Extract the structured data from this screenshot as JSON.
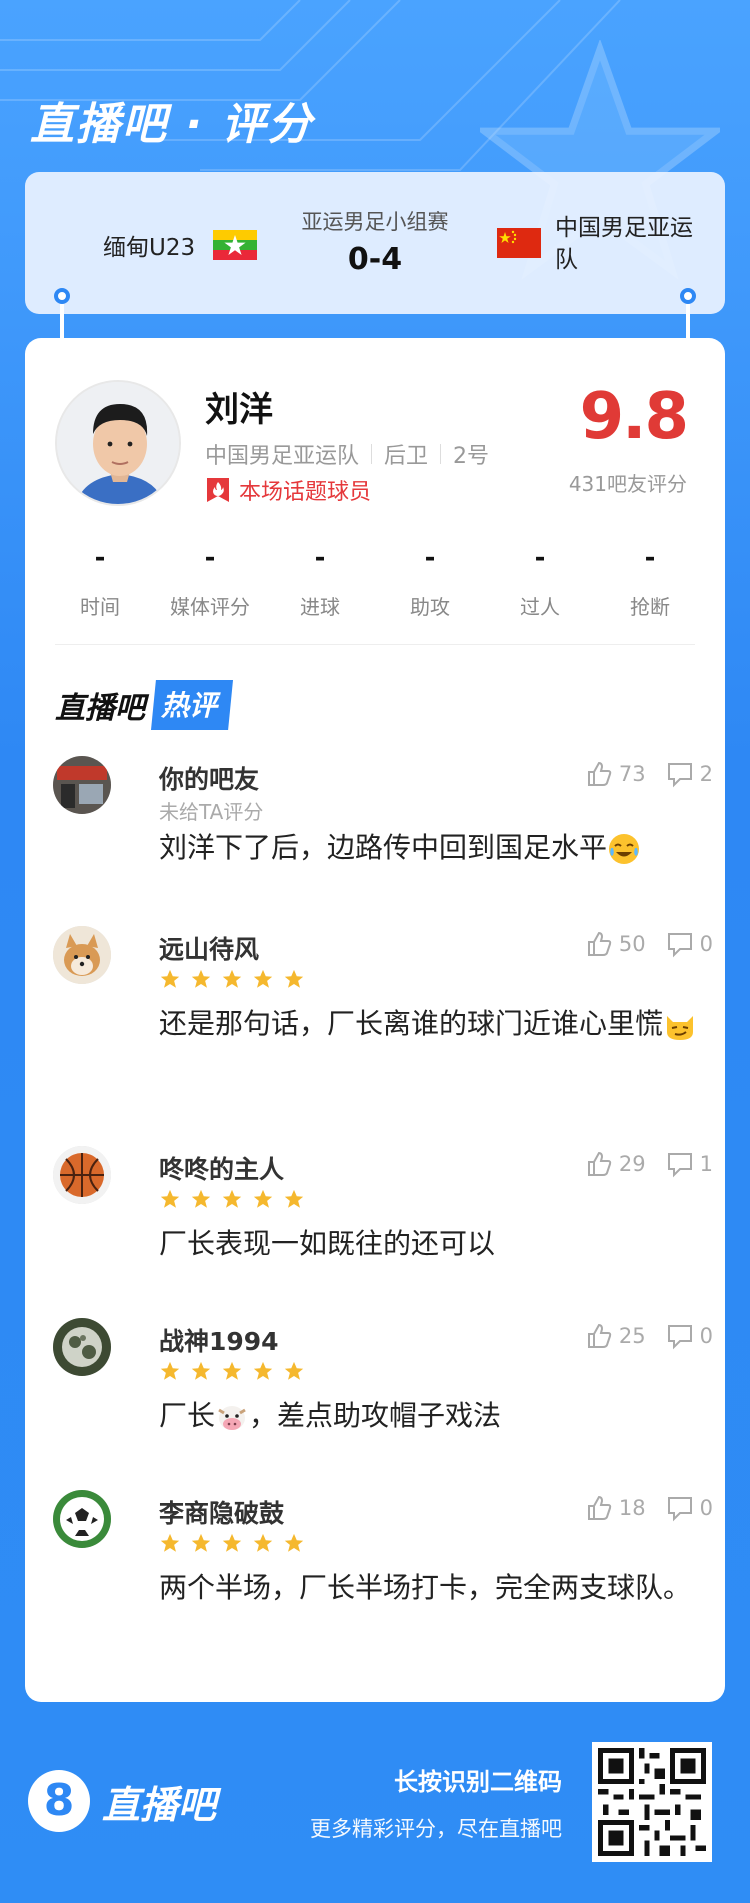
{
  "brand": {
    "title": "直播吧 · 评分"
  },
  "match": {
    "home_team": "缅甸U23",
    "away_team": "中国男足亚运队",
    "competition": "亚运男足小组赛",
    "score": "0-4"
  },
  "player": {
    "name": "刘洋",
    "team": "中国男足亚运队",
    "position": "后卫",
    "number": "2号",
    "hot_tag": "本场话题球员",
    "rating": "9.8",
    "rating_count": "431吧友评分"
  },
  "stats": [
    {
      "value": "-",
      "label": "时间"
    },
    {
      "value": "-",
      "label": "媒体评分"
    },
    {
      "value": "-",
      "label": "进球"
    },
    {
      "value": "-",
      "label": "助攻"
    },
    {
      "value": "-",
      "label": "过人"
    },
    {
      "value": "-",
      "label": "抢断"
    }
  ],
  "hot_comments": {
    "title_a": "直播吧",
    "title_b": "热评",
    "items": [
      {
        "user": "你的吧友",
        "sub": "未给TA评分",
        "stars": 0,
        "likes": "73",
        "replies": "2",
        "text": "刘洋下了后，边路传中回到国足水平",
        "emoji": "crying-laugh-emoji"
      },
      {
        "user": "远山待风",
        "stars": 5,
        "likes": "50",
        "replies": "0",
        "text": "还是那句话，厂长离谁的球门近谁心里慌",
        "emoji": "smirk-cat-emoji"
      },
      {
        "user": "咚咚的主人",
        "stars": 5,
        "likes": "29",
        "replies": "1",
        "text": "厂长表现一如既往的还可以"
      },
      {
        "user": "战神1994",
        "stars": 5,
        "likes": "25",
        "replies": "0",
        "text_a": "厂长",
        "text_b": "，差点助攻帽子戏法",
        "emoji": "cow-emoji"
      },
      {
        "user": "李商隐破鼓",
        "stars": 5,
        "likes": "18",
        "replies": "0",
        "text": "两个半场，厂长半场打卡，完全两支球队。"
      }
    ]
  },
  "footer": {
    "logo_text": "直播吧",
    "logo_digit": "8",
    "hint_title": "长按识别二维码",
    "hint_sub": "更多精彩评分，尽在直播吧"
  },
  "colors": {
    "accent": "#2e88f4",
    "rating_red": "#e03a36",
    "star": "#f5b82e"
  }
}
